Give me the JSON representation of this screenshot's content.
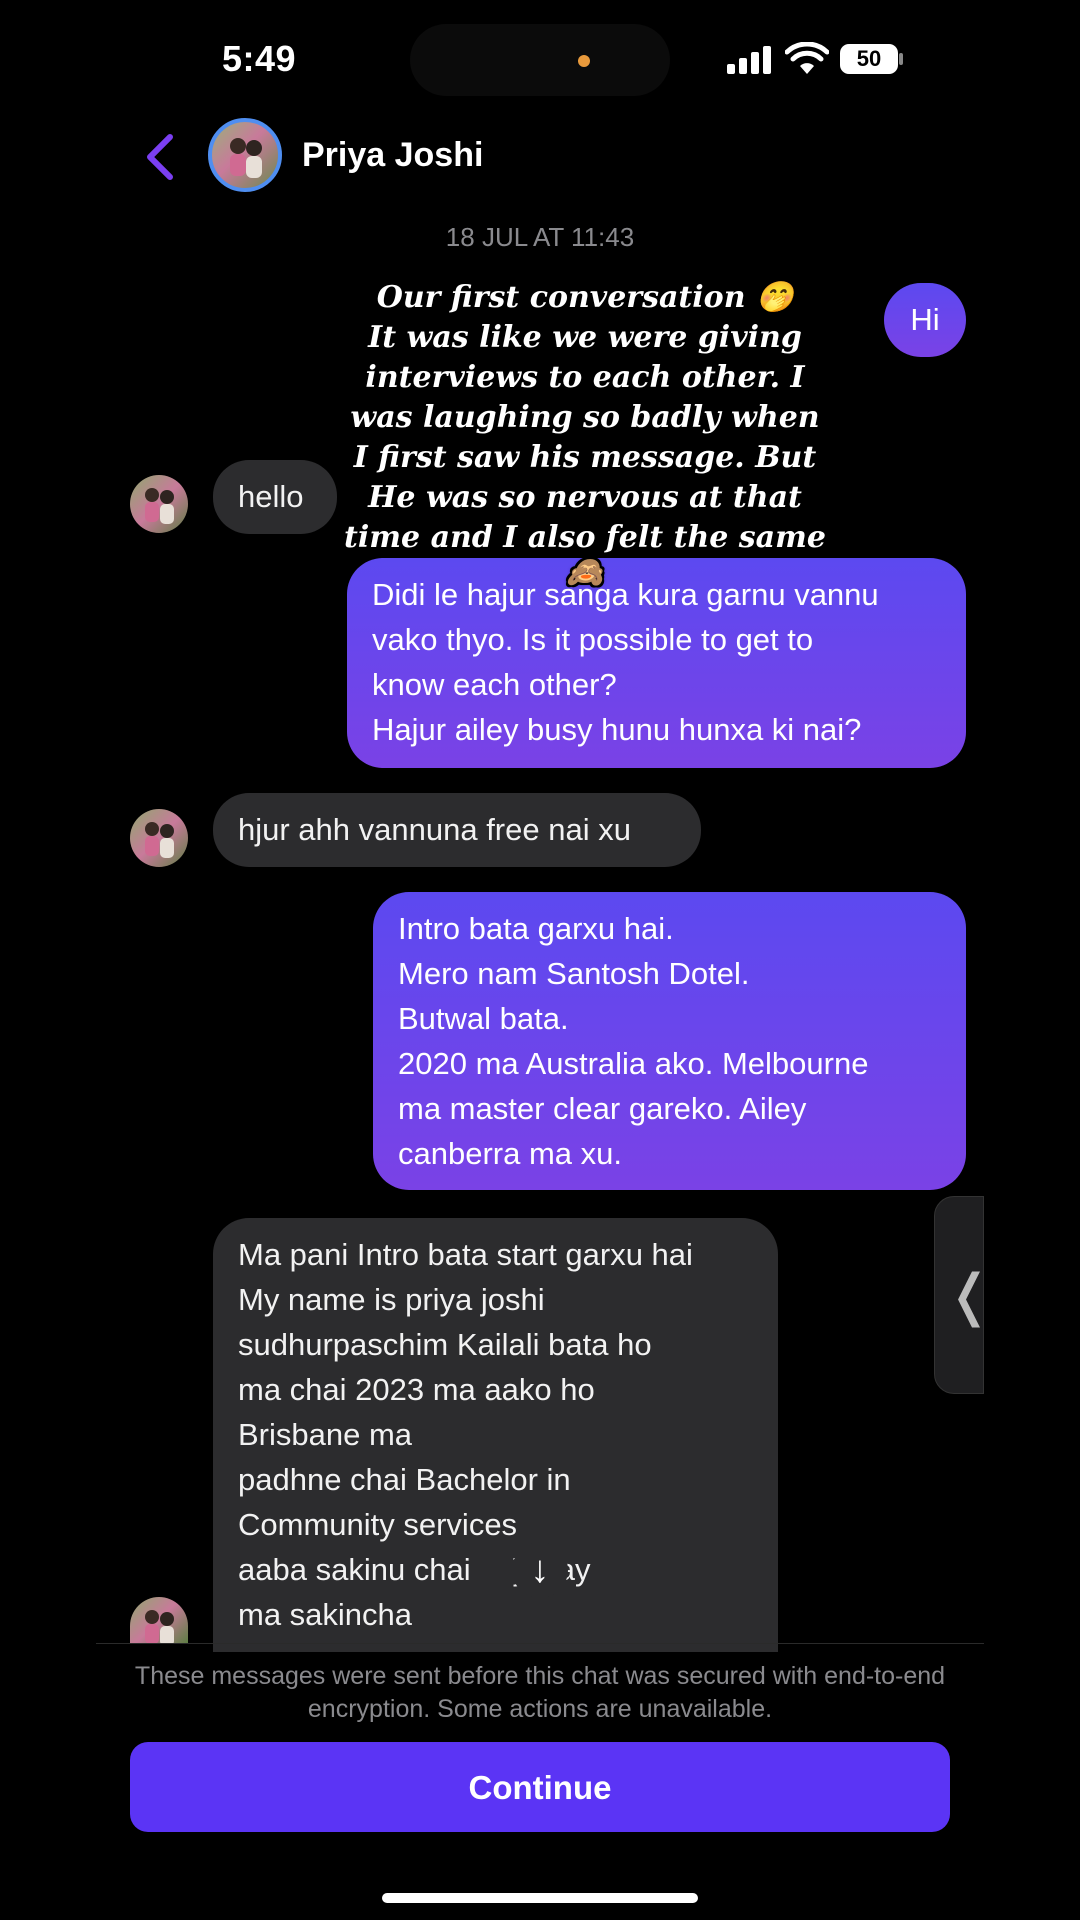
{
  "status_bar": {
    "time": "5:49",
    "battery": "50"
  },
  "header": {
    "contact_name": "Priya Joshi"
  },
  "date_separator": "18 JUL AT 11:43",
  "messages": [
    {
      "from": "me",
      "lines": [
        "Hi"
      ]
    },
    {
      "from": "them",
      "lines": [
        "hello"
      ]
    },
    {
      "from": "me",
      "lines": [
        "Didi le hajur sanga kura garnu vannu",
        "vako thyo. Is it possible to get to",
        "know each other?",
        "Hajur ailey busy hunu hunxa ki nai?"
      ]
    },
    {
      "from": "them",
      "lines": [
        "hjur ahh vannuna free nai xu"
      ]
    },
    {
      "from": "me",
      "lines": [
        "Intro bata garxu hai.",
        "Mero nam Santosh Dotel.",
        "Butwal bata.",
        "2020 ma Australia ako. Melbourne",
        "ma master clear gareko. Ailey",
        "canberra ma xu."
      ]
    },
    {
      "from": "them",
      "lines": [
        "Ma pani Intro bata start garxu hai",
        "My name is priya joshi",
        "sudhurpaschim Kailali bata ho",
        "ma chai 2023 ma aako ho",
        "Brisbane ma",
        "padhne chai Bachelor in",
        "Community services",
        "aaba sakinu chai",
        "ma sakincha"
      ],
      "partial_after_line_8": "} may"
    }
  ],
  "overlay_caption": {
    "lines": [
      "Our first conversation 🤭",
      "It was like we were giving",
      "interviews to each other. I",
      "was laughing so badly when",
      "I first saw his message. But",
      "He was so nervous at that",
      "time and I also felt the same",
      "🙈"
    ]
  },
  "encryption_notice": "These messages were sent before this chat was secured with end-to-end encryption. Some actions are unavailable.",
  "continue_button": "Continue",
  "icons": {
    "back": "chevron-left-icon",
    "side_tab": "chevron-left-icon",
    "scroll_down": "arrow-down-icon",
    "scroll_down_glyph": "↓",
    "side_tab_glyph": "❬"
  },
  "colors": {
    "accent": "#5b34f5",
    "outgoing_bubble": "#6a46ec",
    "incoming_bubble": "#2c2c2e",
    "background": "#000000"
  }
}
